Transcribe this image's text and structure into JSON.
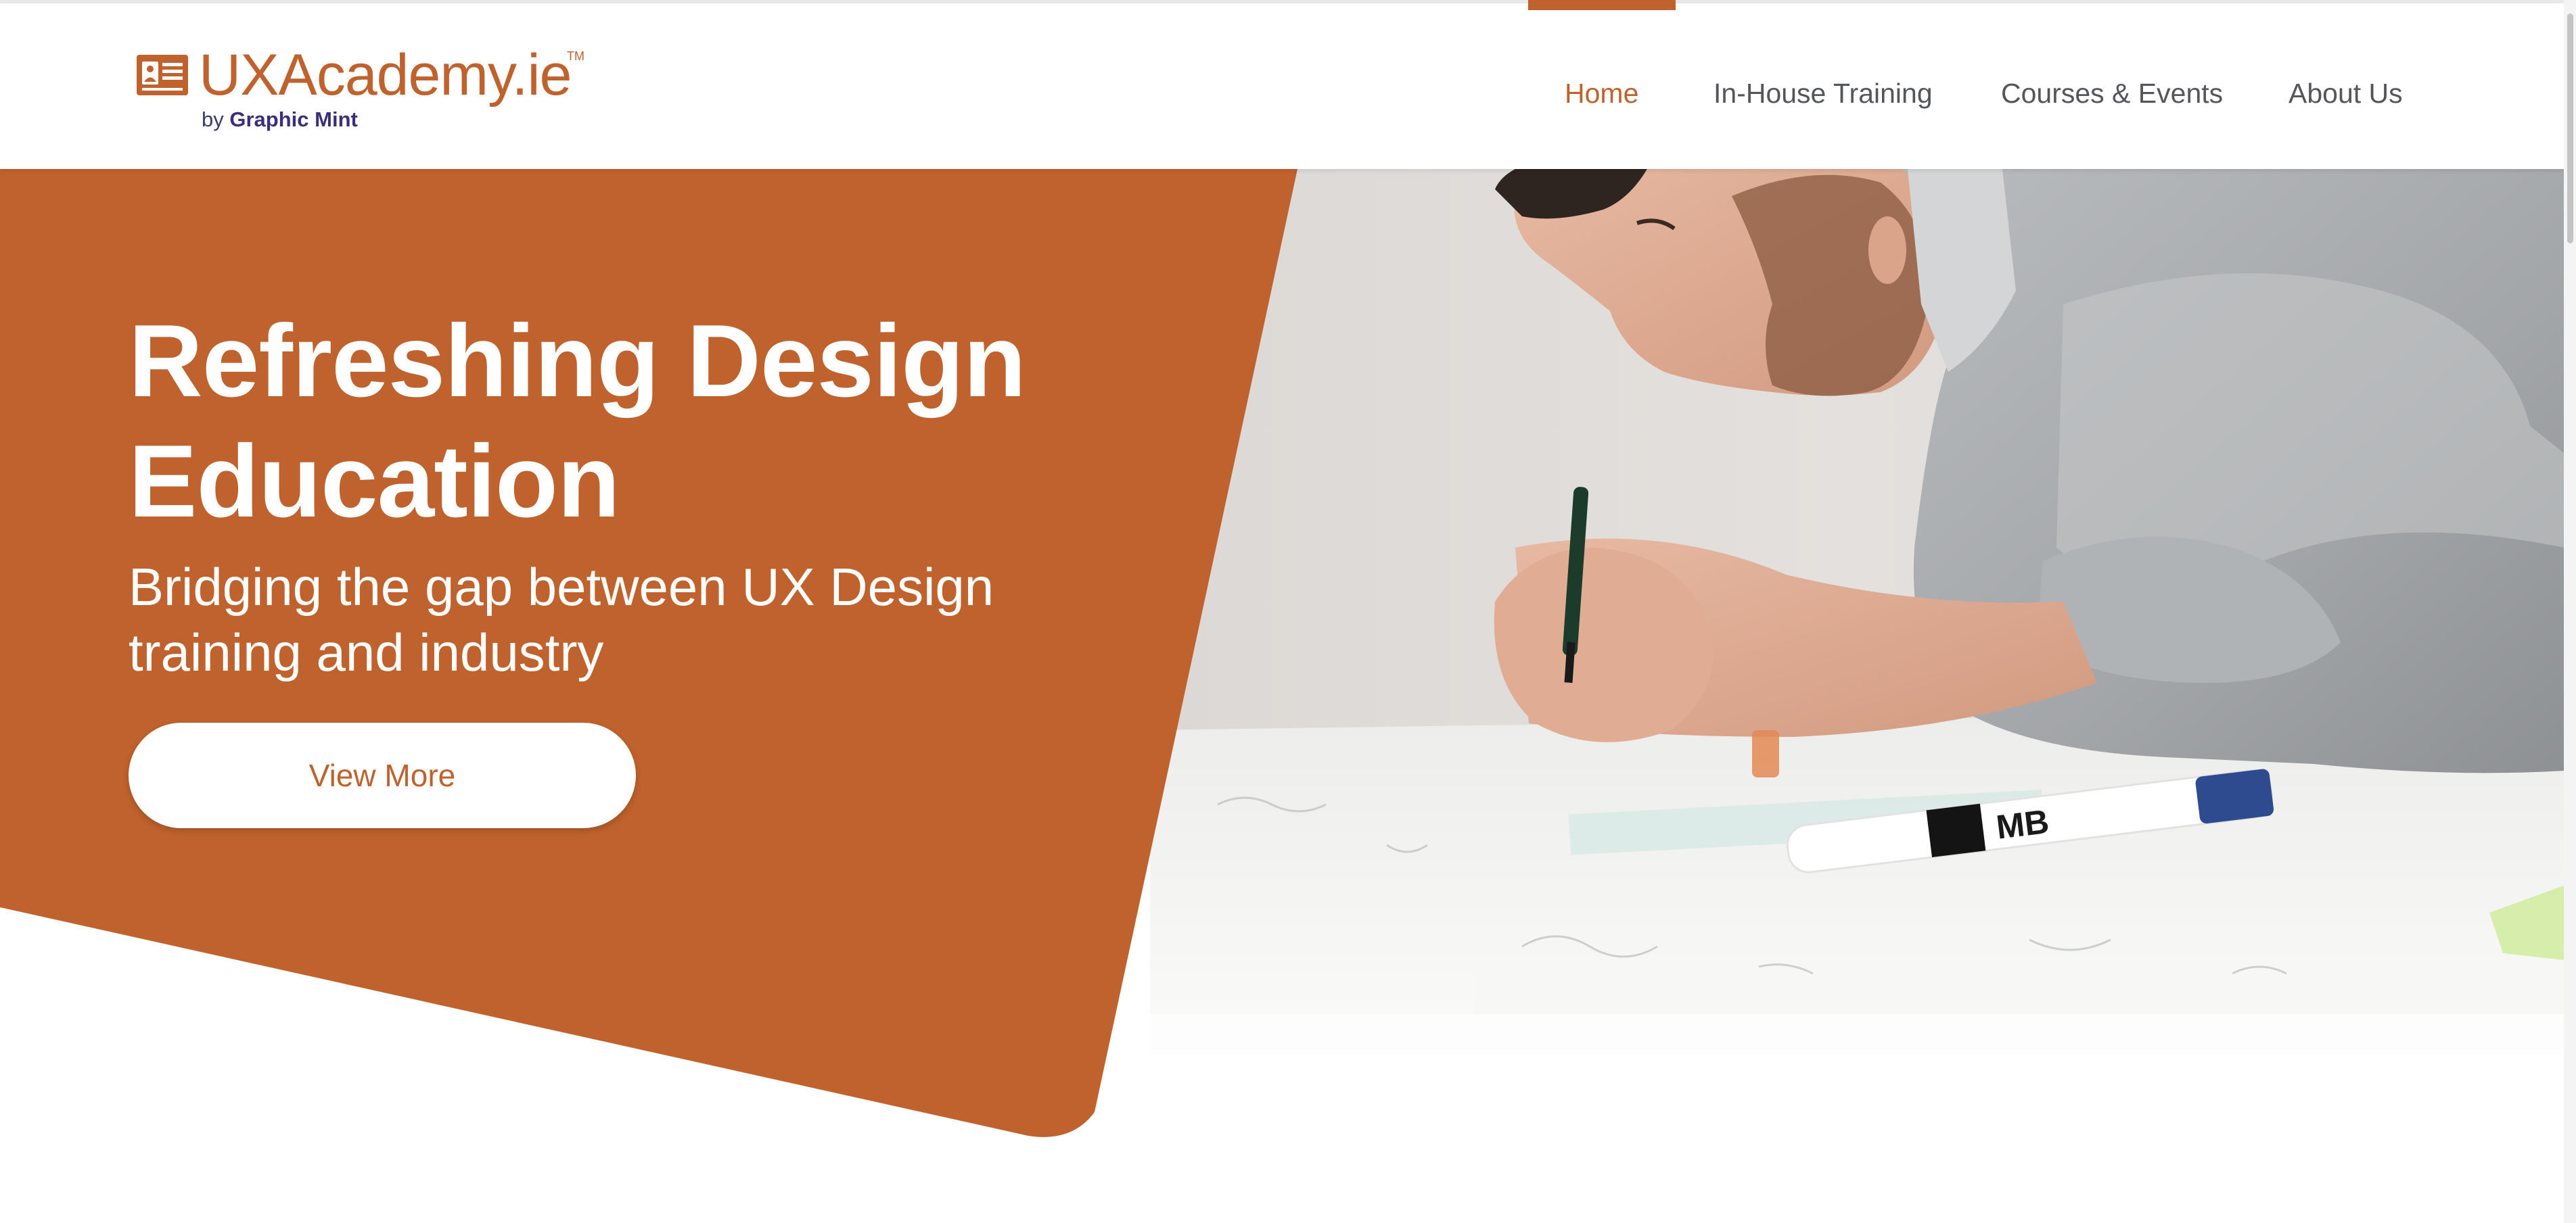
{
  "header": {
    "logo": {
      "brand": "UXAcademy.ie",
      "trademark": "TM",
      "by": "by",
      "company": "Graphic Mint"
    },
    "nav": [
      {
        "label": "Home",
        "active": true
      },
      {
        "label": "In-House Training",
        "active": false
      },
      {
        "label": "Courses & Events",
        "active": false
      },
      {
        "label": "About Us",
        "active": false
      }
    ]
  },
  "hero": {
    "title": "Refreshing Design Education",
    "subtitle": "Bridging the gap between UX Design training and industry",
    "cta_label": "View More",
    "photo_marker_text": "MB"
  },
  "colors": {
    "brand_orange": "#c0622d",
    "logo_navy": "#3a2f7a",
    "nav_text": "#55565a",
    "white": "#ffffff"
  },
  "icons": {
    "logo_mark": "id-card-icon"
  }
}
